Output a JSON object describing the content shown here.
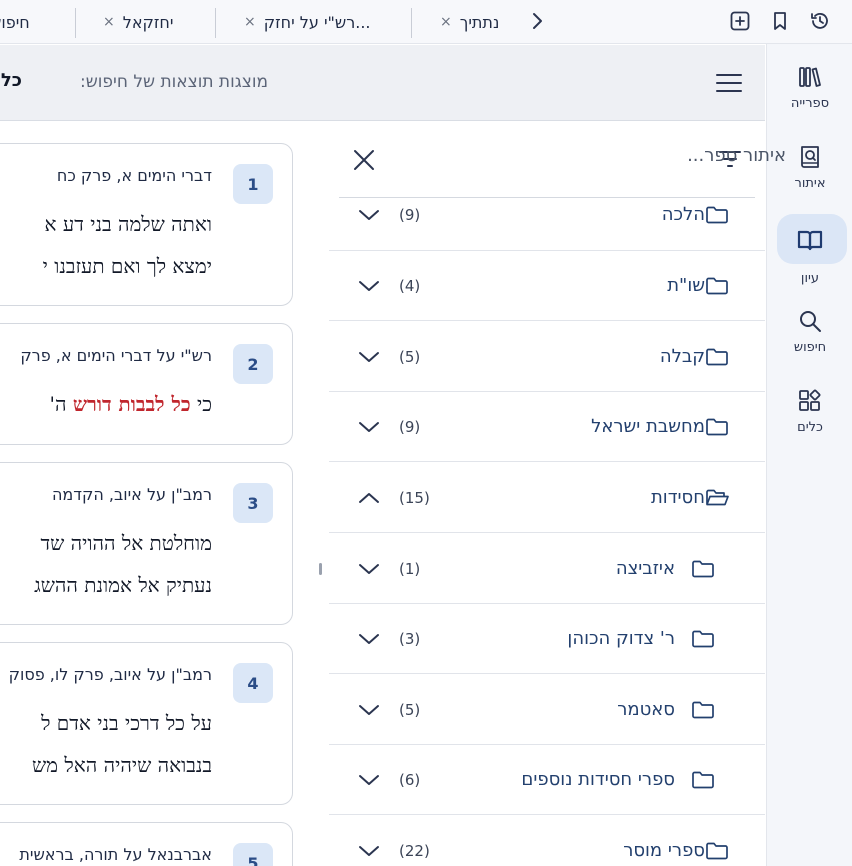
{
  "tabs": [
    {
      "label": "חיפוש"
    },
    {
      "label": "יחזקאל"
    },
    {
      "label": "רש\"י על יחזק..."
    },
    {
      "label": "נתתיך"
    }
  ],
  "tab_close_glyph": "×",
  "top_icons": [
    "history-icon",
    "bookmark-icon",
    "new-tab-icon",
    "chevron-right-icon"
  ],
  "rail": {
    "items": [
      {
        "label": "ספרייה",
        "icon": "library-icon"
      },
      {
        "label": "איתור",
        "icon": "find-book-icon"
      },
      {
        "label": "עיון",
        "icon": "open-book-icon"
      },
      {
        "label": "חיפוש",
        "icon": "search-icon"
      },
      {
        "label": "כלים",
        "icon": "tools-icon"
      }
    ],
    "active": "עיון"
  },
  "header": {
    "results_label": "מוצגות תוצאות של חיפוש:",
    "query": "כל + ל"
  },
  "filter": {
    "placeholder": "איתור ספר...",
    "categories": [
      {
        "name": "הלכה",
        "count": "(9)",
        "expanded": false,
        "indent": false
      },
      {
        "name": "שו\"ת",
        "count": "(4)",
        "expanded": false,
        "indent": false
      },
      {
        "name": "קבלה",
        "count": "(5)",
        "expanded": false,
        "indent": false
      },
      {
        "name": "מחשבת ישראל",
        "count": "(9)",
        "expanded": false,
        "indent": false
      },
      {
        "name": "חסידות",
        "count": "(15)",
        "expanded": true,
        "indent": false
      },
      {
        "name": "איזביצה",
        "count": "(1)",
        "expanded": false,
        "indent": true
      },
      {
        "name": "ר' צדוק הכוהן",
        "count": "(3)",
        "expanded": false,
        "indent": true
      },
      {
        "name": "סאטמר",
        "count": "(5)",
        "expanded": false,
        "indent": true
      },
      {
        "name": "ספרי חסידות נוספים",
        "count": "(6)",
        "expanded": false,
        "indent": true
      },
      {
        "name": "ספרי מוסר",
        "count": "(22)",
        "expanded": false,
        "indent": false
      }
    ]
  },
  "results": [
    {
      "num": "1",
      "source": "דברי הימים א, פרק כח",
      "lines": [
        [
          {
            "t": "ואתה שלמה בני דע א"
          }
        ],
        [
          {
            "t": "ימצא לך ואם תעזבנו י"
          }
        ]
      ]
    },
    {
      "num": "2",
      "source": "רש\"י על דברי הימים א, פרק",
      "lines": [
        [
          {
            "t": "כי "
          },
          {
            "t": "כל לבבות דורש",
            "hl": true
          },
          {
            "t": " ה'"
          }
        ]
      ]
    },
    {
      "num": "3",
      "source": "רמב\"ן על איוב, הקדמה",
      "lines": [
        [
          {
            "t": "מוחלטת אל ההויה שד"
          }
        ],
        [
          {
            "t": "נעתיק אל אמונת ההשג"
          }
        ]
      ]
    },
    {
      "num": "4",
      "source": "רמב\"ן על איוב, פרק לו, פסוק",
      "lines": [
        [
          {
            "t": "על כל דרכי בני אדם ל"
          }
        ],
        [
          {
            "t": "בנבואה שיהיה האל מש"
          }
        ]
      ]
    },
    {
      "num": "5",
      "source": "אברבנאל על תורה, בראשית",
      "lines": []
    }
  ]
}
